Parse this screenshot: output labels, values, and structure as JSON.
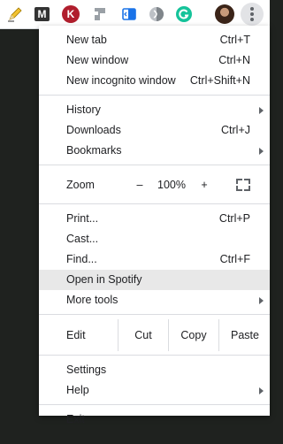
{
  "toolbar": {
    "extensions": [
      {
        "name": "pencil-extension-icon"
      },
      {
        "name": "m-extension-icon",
        "glyph": "M"
      },
      {
        "name": "k-extension-icon",
        "glyph": "K"
      },
      {
        "name": "grey-shape-extension-icon"
      },
      {
        "name": "blue-doc-extension-icon"
      },
      {
        "name": "grey-circle-extension-icon"
      },
      {
        "name": "grammarly-extension-icon"
      }
    ],
    "accent_colors": {
      "k": "#b01e2d",
      "grammarly": "#15c39a",
      "pencil": "#f2b600"
    }
  },
  "menu": {
    "new_tab": {
      "label": "New tab",
      "shortcut": "Ctrl+T"
    },
    "new_window": {
      "label": "New window",
      "shortcut": "Ctrl+N"
    },
    "new_incognito": {
      "label": "New incognito window",
      "shortcut": "Ctrl+Shift+N"
    },
    "history": {
      "label": "History"
    },
    "downloads": {
      "label": "Downloads",
      "shortcut": "Ctrl+J"
    },
    "bookmarks": {
      "label": "Bookmarks"
    },
    "zoom": {
      "label": "Zoom",
      "minus": "–",
      "value": "100%",
      "plus": "+"
    },
    "print": {
      "label": "Print...",
      "shortcut": "Ctrl+P"
    },
    "cast": {
      "label": "Cast..."
    },
    "find": {
      "label": "Find...",
      "shortcut": "Ctrl+F"
    },
    "open_spotify": {
      "label": "Open in Spotify"
    },
    "more_tools": {
      "label": "More tools"
    },
    "edit": {
      "label": "Edit",
      "cut": "Cut",
      "copy": "Copy",
      "paste": "Paste"
    },
    "settings": {
      "label": "Settings"
    },
    "help": {
      "label": "Help"
    },
    "exit": {
      "label": "Exit"
    }
  }
}
